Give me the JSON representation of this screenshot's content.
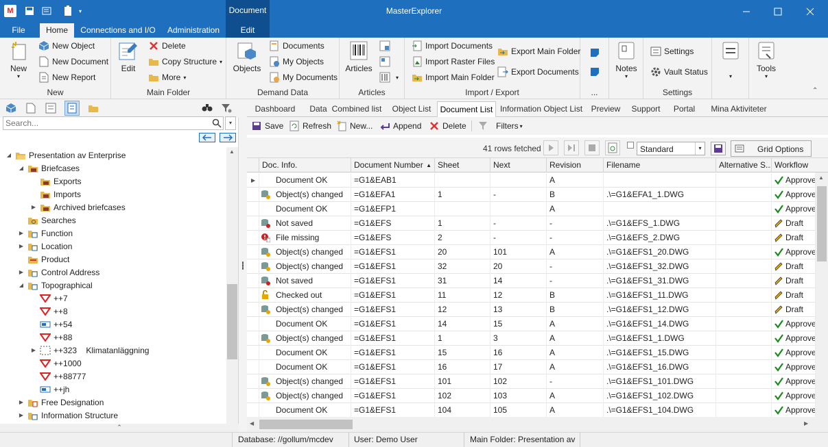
{
  "window": {
    "title": "MasterExplorer",
    "contextual_tab_group": "Document"
  },
  "ribbon_tabs": [
    "File",
    "Home",
    "Connections and I/O",
    "Administration",
    "Edit"
  ],
  "ribbon": {
    "new": {
      "big": "New",
      "items": [
        "New Object",
        "New Document",
        "New Report"
      ],
      "label": "New"
    },
    "main_folder": {
      "edit": "Edit",
      "items": [
        "Delete",
        "Copy Structure",
        "More"
      ],
      "label": "Main Folder"
    },
    "demand_data": {
      "objects": "Objects",
      "items": [
        "Documents",
        "My Objects",
        "My Documents"
      ],
      "label": "Demand Data"
    },
    "articles": {
      "big": "Articles",
      "label": "Articles"
    },
    "import_export": {
      "items": [
        "Import Documents",
        "Import Raster Files",
        "Import Main Folder",
        "Export Main Folder",
        "Export Documents"
      ],
      "label": "Import / Export"
    },
    "notes": {
      "big": "Notes",
      "dots": "..."
    },
    "settings": {
      "items": [
        "Settings",
        "Vault Status"
      ],
      "label": "Settings"
    },
    "tools": {
      "big": "Tools"
    }
  },
  "left": {
    "search_placeholder": "Search...",
    "tree": [
      {
        "label": "Presentation av Enterprise",
        "level": 0,
        "expander": "open",
        "icon": "folder-open"
      },
      {
        "label": "Briefcases",
        "level": 1,
        "expander": "open",
        "icon": "briefcase-folder"
      },
      {
        "label": "Exports",
        "level": 2,
        "expander": "",
        "icon": "briefcase-folder"
      },
      {
        "label": "Imports",
        "level": 2,
        "expander": "",
        "icon": "briefcase-folder"
      },
      {
        "label": "Archived briefcases",
        "level": 2,
        "expander": "closed",
        "icon": "briefcase-folder"
      },
      {
        "label": "Searches",
        "level": 1,
        "expander": "",
        "icon": "search-folder"
      },
      {
        "label": "Function",
        "level": 1,
        "expander": "closed",
        "icon": "structure-folder"
      },
      {
        "label": "Location",
        "level": 1,
        "expander": "closed",
        "icon": "structure-folder"
      },
      {
        "label": "Product",
        "level": 1,
        "expander": "",
        "icon": "product-folder"
      },
      {
        "label": "Control Address",
        "level": 1,
        "expander": "closed",
        "icon": "structure-folder"
      },
      {
        "label": "Topographical",
        "level": 1,
        "expander": "open",
        "icon": "structure-folder"
      },
      {
        "label": "++7",
        "level": 2,
        "expander": "",
        "icon": "red-triangle"
      },
      {
        "label": "++8",
        "level": 2,
        "expander": "",
        "icon": "red-triangle"
      },
      {
        "label": "++54",
        "level": 2,
        "expander": "",
        "icon": "blue-tag"
      },
      {
        "label": "++88",
        "level": 2,
        "expander": "",
        "icon": "red-triangle"
      },
      {
        "label": "++323    Klimatanläggning",
        "level": 2,
        "expander": "closed",
        "icon": "dashed-box"
      },
      {
        "label": "++1000",
        "level": 2,
        "expander": "",
        "icon": "red-triangle"
      },
      {
        "label": "++88777",
        "level": 2,
        "expander": "",
        "icon": "red-triangle"
      },
      {
        "label": "++jh",
        "level": 2,
        "expander": "",
        "icon": "blue-tag"
      },
      {
        "label": "Free Designation",
        "level": 1,
        "expander": "closed",
        "icon": "free-folder"
      },
      {
        "label": "Information Structure",
        "level": 1,
        "expander": "closed",
        "icon": "structure-folder"
      }
    ]
  },
  "doc_tabs": [
    "Dashboard",
    "Data",
    "Combined list",
    "Object List",
    "Document List",
    "Information Object List",
    "Preview",
    "Support",
    "Portal",
    "Mina Aktiviteter"
  ],
  "active_doc_tab": "Document List",
  "toolbar": {
    "save": "Save",
    "refresh": "Refresh",
    "new": "New...",
    "append": "Append",
    "delete": "Delete",
    "filters": "Filters"
  },
  "grid_toolbar": {
    "rows_fetched": "41 rows fetched",
    "layout": "Standard",
    "grid_options": "Grid Options"
  },
  "grid": {
    "columns": [
      "Doc. Info.",
      "Document Number",
      "Sheet",
      "Next",
      "Revision",
      "Filename",
      "Alternative S...",
      "Workflow"
    ],
    "rows": [
      {
        "icon": "",
        "info": "Document OK",
        "number": "=G1&EAB1",
        "sheet": "",
        "next": "",
        "rev": "A",
        "file": "",
        "alt": "",
        "wf": "Approved",
        "wficon": "check"
      },
      {
        "icon": "changed",
        "info": "Object(s) changed",
        "number": "=G1&EFA1",
        "sheet": "1",
        "next": "-",
        "rev": "B",
        "file": ".\\=G1&EFA1_1.DWG",
        "alt": "",
        "wf": "Approved",
        "wficon": "check"
      },
      {
        "icon": "",
        "info": "Document OK",
        "number": "=G1&EFP1",
        "sheet": "",
        "next": "",
        "rev": "A",
        "file": "",
        "alt": "",
        "wf": "Approved",
        "wficon": "check"
      },
      {
        "icon": "notsaved",
        "info": "Not saved",
        "number": "=G1&EFS",
        "sheet": "1",
        "next": "-",
        "rev": "-",
        "file": ".\\=G1&EFS_1.DWG",
        "alt": "",
        "wf": "Draft",
        "wficon": "pencil"
      },
      {
        "icon": "missing",
        "info": "File missing",
        "number": "=G1&EFS",
        "sheet": "2",
        "next": "-",
        "rev": "-",
        "file": ".\\=G1&EFS_2.DWG",
        "alt": "",
        "wf": "Draft",
        "wficon": "pencil"
      },
      {
        "icon": "changed",
        "info": "Object(s) changed",
        "number": "=G1&EFS1",
        "sheet": "20",
        "next": "101",
        "rev": "A",
        "file": ".\\=G1&EFS1_20.DWG",
        "alt": "",
        "wf": "Approved",
        "wficon": "check"
      },
      {
        "icon": "changed",
        "info": "Object(s) changed",
        "number": "=G1&EFS1",
        "sheet": "32",
        "next": "20",
        "rev": "-",
        "file": ".\\=G1&EFS1_32.DWG",
        "alt": "",
        "wf": "Draft",
        "wficon": "pencil"
      },
      {
        "icon": "notsaved",
        "info": "Not saved",
        "number": "=G1&EFS1",
        "sheet": "31",
        "next": "14",
        "rev": "-",
        "file": ".\\=G1&EFS1_31.DWG",
        "alt": "",
        "wf": "Draft",
        "wficon": "pencil"
      },
      {
        "icon": "lock",
        "info": "Checked out",
        "number": "=G1&EFS1",
        "sheet": "11",
        "next": "12",
        "rev": "B",
        "file": ".\\=G1&EFS1_11.DWG",
        "alt": "",
        "wf": "Draft",
        "wficon": "pencil"
      },
      {
        "icon": "changed",
        "info": "Object(s) changed",
        "number": "=G1&EFS1",
        "sheet": "12",
        "next": "13",
        "rev": "B",
        "file": ".\\=G1&EFS1_12.DWG",
        "alt": "",
        "wf": "Draft",
        "wficon": "pencil"
      },
      {
        "icon": "",
        "info": "Document OK",
        "number": "=G1&EFS1",
        "sheet": "14",
        "next": "15",
        "rev": "A",
        "file": ".\\=G1&EFS1_14.DWG",
        "alt": "",
        "wf": "Approved",
        "wficon": "check"
      },
      {
        "icon": "changed",
        "info": "Object(s) changed",
        "number": "=G1&EFS1",
        "sheet": "1",
        "next": "3",
        "rev": "A",
        "file": ".\\=G1&EFS1_1.DWG",
        "alt": "",
        "wf": "Approved",
        "wficon": "check"
      },
      {
        "icon": "",
        "info": "Document OK",
        "number": "=G1&EFS1",
        "sheet": "15",
        "next": "16",
        "rev": "A",
        "file": ".\\=G1&EFS1_15.DWG",
        "alt": "",
        "wf": "Approved",
        "wficon": "check"
      },
      {
        "icon": "",
        "info": "Document OK",
        "number": "=G1&EFS1",
        "sheet": "16",
        "next": "17",
        "rev": "A",
        "file": ".\\=G1&EFS1_16.DWG",
        "alt": "",
        "wf": "Approved",
        "wficon": "check"
      },
      {
        "icon": "changed",
        "info": "Object(s) changed",
        "number": "=G1&EFS1",
        "sheet": "101",
        "next": "102",
        "rev": "-",
        "file": ".\\=G1&EFS1_101.DWG",
        "alt": "",
        "wf": "Approved",
        "wficon": "check"
      },
      {
        "icon": "changed",
        "info": "Object(s) changed",
        "number": "=G1&EFS1",
        "sheet": "102",
        "next": "103",
        "rev": "A",
        "file": ".\\=G1&EFS1_102.DWG",
        "alt": "",
        "wf": "Approved",
        "wficon": "check"
      },
      {
        "icon": "",
        "info": "Document OK",
        "number": "=G1&EFS1",
        "sheet": "104",
        "next": "105",
        "rev": "A",
        "file": ".\\=G1&EFS1_104.DWG",
        "alt": "",
        "wf": "Approved",
        "wficon": "check"
      }
    ]
  },
  "status": {
    "database": "Database: //gollum/mcdev",
    "user": "User: Demo User",
    "main_folder": "Main Folder: Presentation av"
  }
}
